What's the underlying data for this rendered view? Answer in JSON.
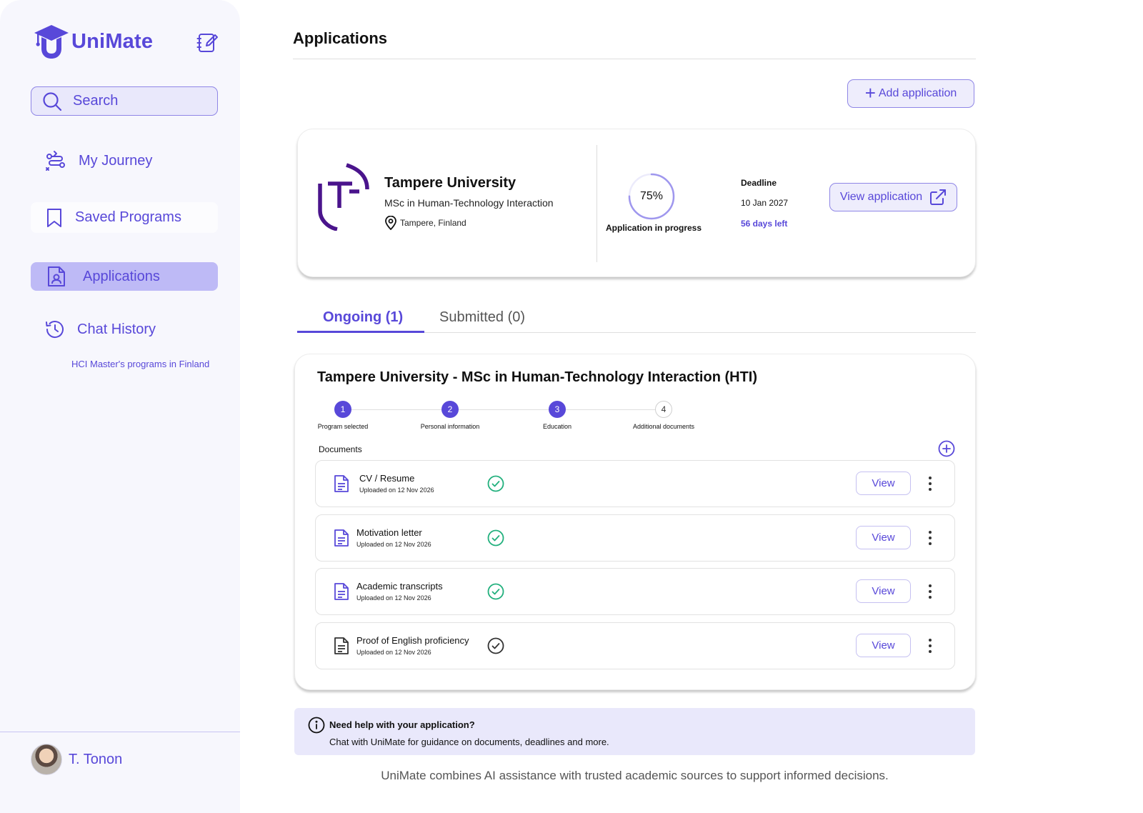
{
  "app": {
    "name": "UniMate"
  },
  "sidebar": {
    "search_placeholder": "Search",
    "items": [
      {
        "label": "My Journey",
        "icon": "route-icon"
      },
      {
        "label": "Saved Programs",
        "icon": "bookmark-icon"
      },
      {
        "label": "Applications",
        "icon": "document-person-icon",
        "active": true
      },
      {
        "label": "Chat History",
        "icon": "history-icon"
      }
    ],
    "chat_history": [
      "HCI Master's programs in Finland"
    ],
    "user": {
      "name": "T. Tonon"
    }
  },
  "page": {
    "title": "Applications",
    "add_button": "Add application"
  },
  "summary": {
    "university": "Tampere University",
    "program": "MSc in Human-Technology Interaction",
    "location": "Tampere, Finland",
    "progress_percent": 75,
    "progress_text": "75%",
    "progress_label": "Application in progress",
    "deadline_label": "Deadline",
    "deadline_date": "10 Jan 2027",
    "days_left": "56 days left",
    "view_button": "View application"
  },
  "tabs": [
    {
      "label": "Ongoing (1)",
      "active": true
    },
    {
      "label": "Submitted (0)",
      "active": false
    }
  ],
  "detail": {
    "title": "Tampere University - MSc in Human-Technology Interaction (HTI)",
    "steps": [
      {
        "number": "1",
        "label": "Program selected",
        "done": true
      },
      {
        "number": "2",
        "label": "Personal information",
        "done": true
      },
      {
        "number": "3",
        "label": "Education",
        "done": true
      },
      {
        "number": "4",
        "label": "Additional documents",
        "done": false
      }
    ],
    "documents_label": "Documents",
    "documents": [
      {
        "name": "CV / Resume",
        "uploaded": "Uploaded on 12 Nov 2026",
        "verified": true,
        "view_label": "View"
      },
      {
        "name": "Motivation letter",
        "uploaded": "Uploaded on 12 Nov 2026",
        "verified": true,
        "view_label": "View"
      },
      {
        "name": "Academic transcripts",
        "uploaded": "Uploaded on 12 Nov 2026",
        "verified": true,
        "view_label": "View"
      },
      {
        "name": "Proof of English proficiency",
        "uploaded": "Uploaded on 12 Nov 2026",
        "verified": false,
        "view_label": "View"
      }
    ]
  },
  "help": {
    "title": "Need help with your application?",
    "text": "Chat with UniMate for guidance on documents, deadlines and more."
  },
  "footer": "UniMate combines AI assistance with trusted academic sources to support informed decisions.",
  "colors": {
    "accent": "#5848d9",
    "accent_light": "#e9e8fb",
    "active_nav": "#bebaf6",
    "success": "#22b07d",
    "logo_purple": "#4a148c"
  }
}
